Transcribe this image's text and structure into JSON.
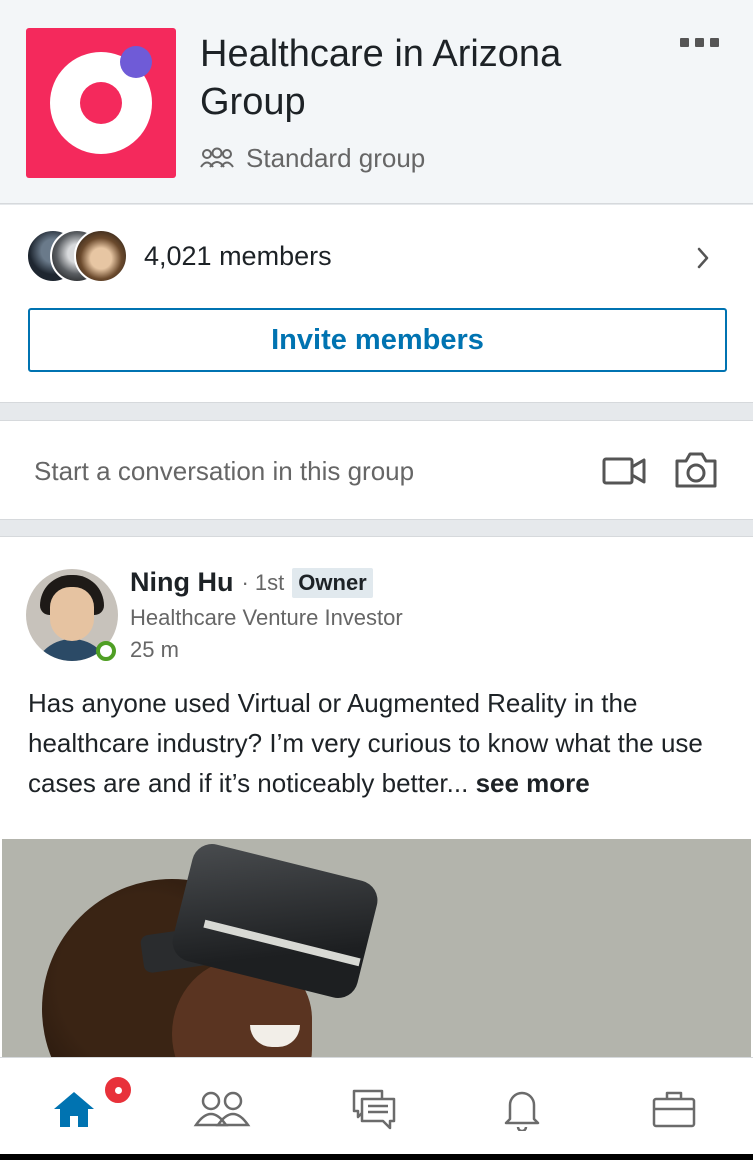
{
  "header": {
    "title": "Healthcare in Arizona Group",
    "group_type": "Standard group",
    "more_icon": "more-horizontal-icon",
    "logo_colors": {
      "background": "#f4295c",
      "ring": "#ffffff",
      "dot": "#6f5bd7"
    }
  },
  "members": {
    "count_label": "4,021 members",
    "invite_label": "Invite members"
  },
  "composer": {
    "placeholder": "Start a conversation in this group",
    "icons": [
      "video-icon",
      "camera-icon"
    ]
  },
  "post": {
    "author": "Ning Hu",
    "degree": "· 1st",
    "badge": "Owner",
    "headline": "Healthcare Venture Investor",
    "time": "25 m",
    "body": "Has anyone used Virtual or Augmented Reality in the healthcare industry? I’m very curious to know what the use cases are and if it’s noticeably better...",
    "see_more": "see more",
    "online": true
  },
  "bottom_nav": {
    "items": [
      {
        "icon": "home-icon",
        "active": true,
        "has_badge": true
      },
      {
        "icon": "my-network-icon",
        "active": false
      },
      {
        "icon": "messaging-icon",
        "active": false
      },
      {
        "icon": "notifications-icon",
        "active": false
      },
      {
        "icon": "jobs-icon",
        "active": false
      }
    ]
  },
  "colors": {
    "accent": "#0073b1",
    "online": "#4f9f24",
    "badge": "#e8313a"
  }
}
